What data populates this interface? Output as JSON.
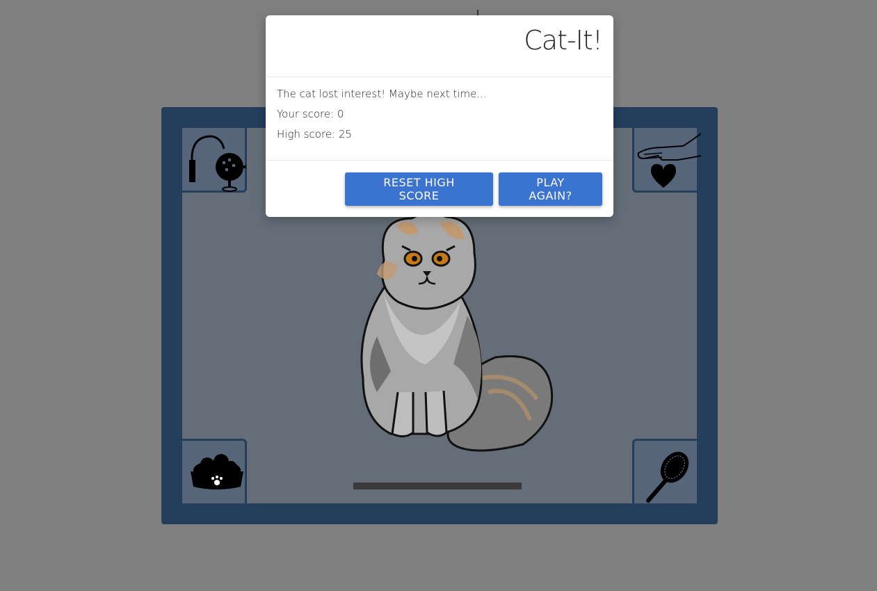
{
  "modal": {
    "title": "Cat-It!",
    "message": "The cat lost interest! Maybe next time...",
    "score_line": "Your score: 0",
    "high_score_line": "High score: 25",
    "reset_label": "RESET HIGH SCORE",
    "play_again_label": "PLAY AGAIN?"
  },
  "game": {
    "score": 0,
    "high_score": 25,
    "interest_level": 1.0,
    "corners": [
      "toy-wand-icon",
      "pet-hand-icon",
      "food-bowl-icon",
      "brush-icon"
    ]
  },
  "colors": {
    "backdrop": "#808080",
    "frame": "#243e5c",
    "play_area": "#646d78",
    "button": "#3b73d1"
  }
}
